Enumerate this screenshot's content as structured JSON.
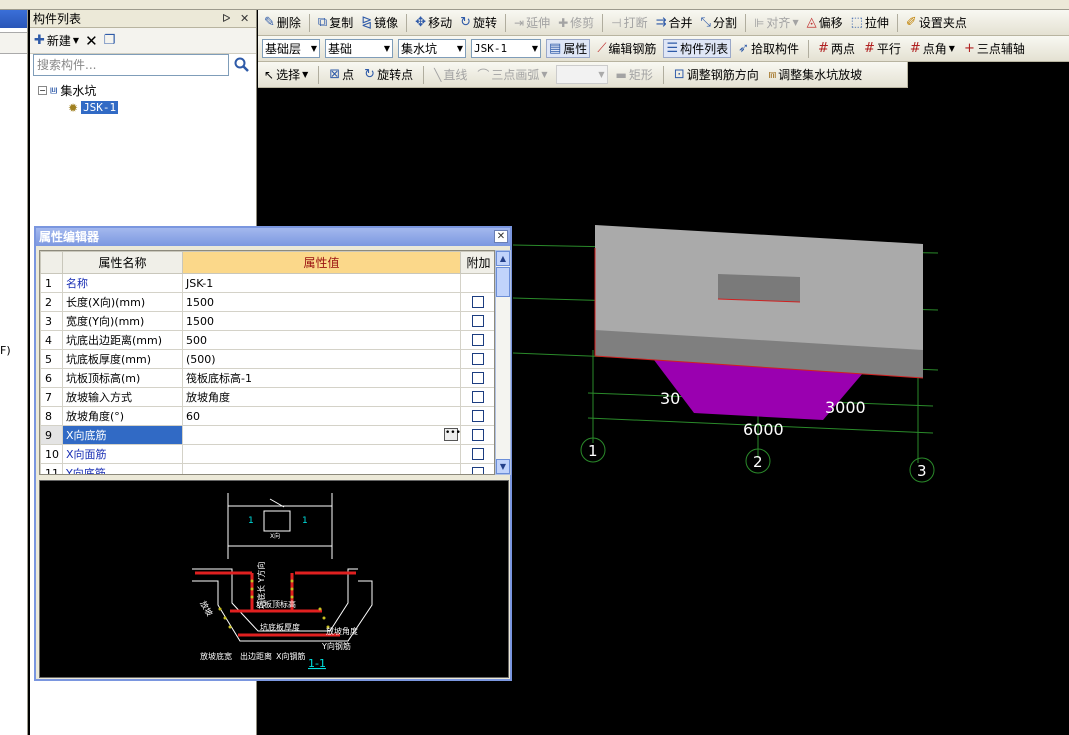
{
  "left_panel": {
    "title": "构件列表",
    "pin_icon": "pin-icon",
    "close_icon": "close-icon",
    "new_label": "新建",
    "search_placeholder": "搜索构件...",
    "tree": {
      "root": "集水坑",
      "child": "JSK-1"
    },
    "left_edge_text": "F)"
  },
  "toolbar1": [
    "删除",
    "复制",
    "镜像",
    "移动",
    "旋转",
    "延伸",
    "修剪",
    "打断",
    "合并",
    "分割",
    "对齐",
    "偏移",
    "拉伸",
    "设置夹点"
  ],
  "toolbar2": {
    "combos": [
      "基础层",
      "基础",
      "集水坑",
      "JSK-1"
    ],
    "buttons": [
      "属性",
      "编辑钢筋",
      "构件列表",
      "拾取构件",
      "两点",
      "平行",
      "点角",
      "三点辅轴"
    ]
  },
  "toolbar3": [
    "选择",
    "点",
    "旋转点",
    "直线",
    "三点画弧",
    "矩形",
    "调整钢筋方向",
    "调整集水坑放坡"
  ],
  "props": {
    "title": "属性编辑器",
    "headers": {
      "name": "属性名称",
      "value": "属性值",
      "extra": "附加"
    },
    "rows": [
      {
        "n": "1",
        "name": "名称",
        "value": "JSK-1"
      },
      {
        "n": "2",
        "name": "长度(X向)(mm)",
        "value": "1500"
      },
      {
        "n": "3",
        "name": "宽度(Y向)(mm)",
        "value": "1500"
      },
      {
        "n": "4",
        "name": "坑底出边距离(mm)",
        "value": "500"
      },
      {
        "n": "5",
        "name": "坑底板厚度(mm)",
        "value": "(500)"
      },
      {
        "n": "6",
        "name": "坑板顶标高(m)",
        "value": "筏板底标高-1"
      },
      {
        "n": "7",
        "name": "放坡输入方式",
        "value": "放坡角度"
      },
      {
        "n": "8",
        "name": "放坡角度(°)",
        "value": "60"
      },
      {
        "n": "9",
        "name": "X向底筋",
        "value": ""
      },
      {
        "n": "10",
        "name": "X向面筋",
        "value": ""
      },
      {
        "n": "11",
        "name": "Y向底筋",
        "value": ""
      }
    ]
  },
  "preview": {
    "section": "1-1",
    "marks": [
      "1",
      "1",
      "X向",
      "坑底长 Y方向",
      "坑板顶标高",
      "坑底板厚度",
      "放坡角度",
      "Y向钢筋",
      "放坡底宽",
      "出边距离",
      "X向钢筋",
      "放坡"
    ]
  },
  "canvas": {
    "dims": [
      "30",
      "3000",
      "6000"
    ],
    "axes": [
      "1",
      "2",
      "3"
    ]
  },
  "colors": {
    "accent": "#316ac5",
    "header_value": "#fbd88a",
    "magenta": "#9a00b0"
  }
}
